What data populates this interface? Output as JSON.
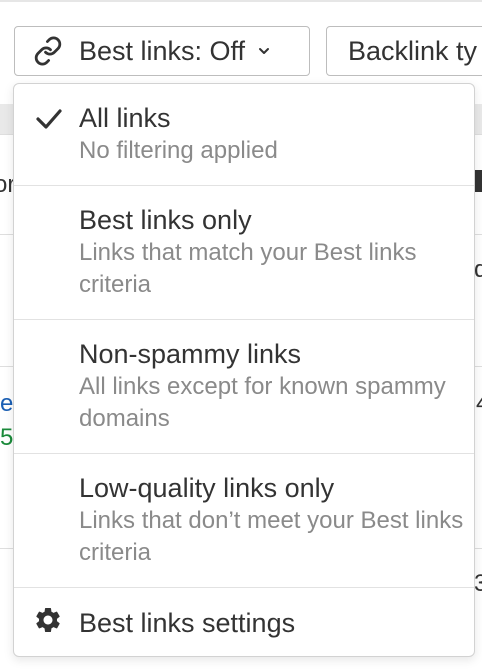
{
  "toolbar": {
    "best_links_button": "Best links: Off",
    "backlink_button": "Backlink ty"
  },
  "background": {
    "frag_or": "or",
    "frag_e": "e",
    "frag_5": "5",
    "frag_d": "d",
    "frag_4": "4",
    "frag_3": "3"
  },
  "menu": {
    "items": [
      {
        "title": "All links",
        "description": "No filtering applied"
      },
      {
        "title": "Best links only",
        "description": "Links that match your Best links criteria"
      },
      {
        "title": "Non-spammy links",
        "description": "All links except for known spammy domains"
      },
      {
        "title": "Low-quality links only",
        "description": "Links that don’t meet your Best links criteria"
      }
    ],
    "settings_label": "Best links settings"
  },
  "icons": {
    "link": "link-icon",
    "chevron": "chevron-down-icon",
    "check": "check-icon",
    "gear": "gear-icon"
  },
  "colors": {
    "link_blue": "#1a5fb4",
    "value_green": "#1a8a3a",
    "text": "#333333",
    "muted": "#8a8a8a"
  }
}
